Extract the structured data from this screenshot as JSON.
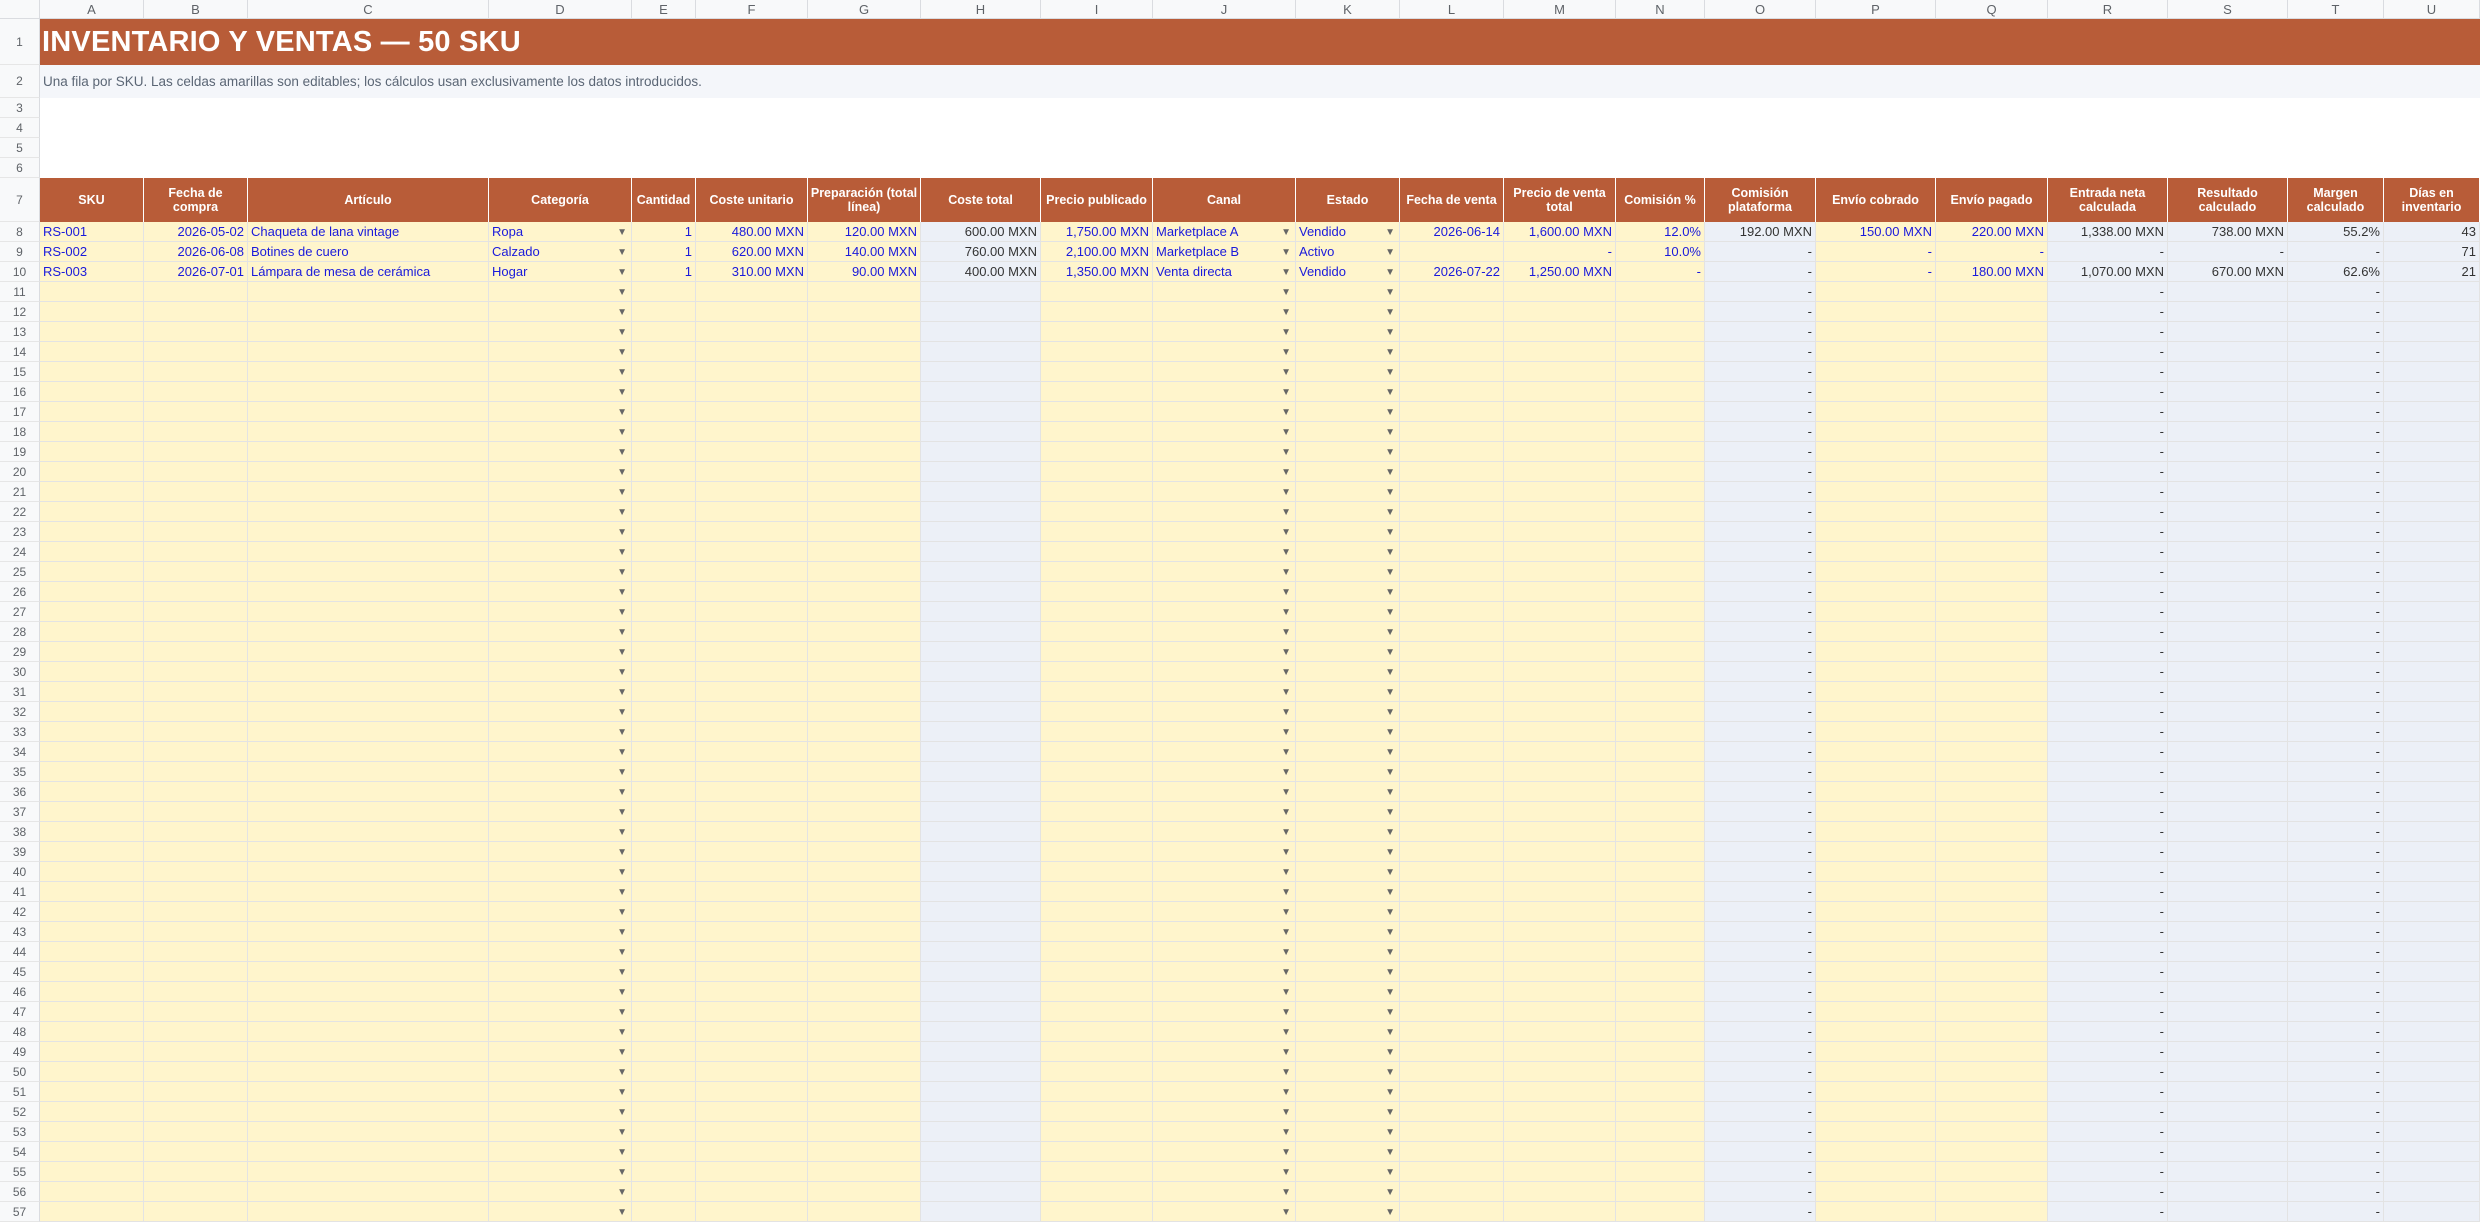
{
  "columns": [
    "A",
    "B",
    "C",
    "D",
    "E",
    "F",
    "G",
    "H",
    "I",
    "J",
    "K",
    "L",
    "M",
    "N",
    "O",
    "P",
    "Q",
    "R",
    "S",
    "T",
    "U"
  ],
  "title": "INVENTARIO Y VENTAS — 50 SKU",
  "subtitle": "Una fila por SKU. Las celdas amarillas son editables; los cálculos usan exclusivamente los datos introducidos.",
  "headers": [
    "SKU",
    "Fecha de compra",
    "Artículo",
    "Categoría",
    "Cantidad",
    "Coste unitario",
    "Preparación (total línea)",
    "Coste total",
    "Precio publicado",
    "Canal",
    "Estado",
    "Fecha de venta",
    "Precio de venta total",
    "Comisión %",
    "Comisión plataforma",
    "Envío cobrado",
    "Envío pagado",
    "Entrada neta calculada",
    "Resultado calculado",
    "Margen calculado",
    "Días en inventario"
  ],
  "rows": [
    {
      "row_number": "8",
      "cells": [
        "RS-001",
        "2026-05-02",
        "Chaqueta de lana vintage",
        "Ropa",
        "1",
        "480.00 MXN",
        "120.00 MXN",
        "600.00 MXN",
        "1,750.00 MXN",
        "Marketplace A",
        "Vendido",
        "2026-06-14",
        "1,600.00 MXN",
        "12.0%",
        "192.00 MXN",
        "150.00 MXN",
        "220.00 MXN",
        "1,338.00 MXN",
        "738.00 MXN",
        "55.2%",
        "43"
      ]
    },
    {
      "row_number": "9",
      "cells": [
        "RS-002",
        "2026-06-08",
        "Botines de cuero",
        "Calzado",
        "1",
        "620.00 MXN",
        "140.00 MXN",
        "760.00 MXN",
        "2,100.00 MXN",
        "Marketplace B",
        "Activo",
        "",
        "-",
        "10.0%",
        "-",
        "-",
        "-",
        "-",
        "-",
        "-",
        "71"
      ]
    },
    {
      "row_number": "10",
      "cells": [
        "RS-003",
        "2026-07-01",
        "Lámpara de mesa de cerámica",
        "Hogar",
        "1",
        "310.00 MXN",
        "90.00 MXN",
        "400.00 MXN",
        "1,350.00 MXN",
        "Venta directa",
        "Vendido",
        "2026-07-22",
        "1,250.00 MXN",
        "-",
        "-",
        "-",
        "180.00 MXN",
        "1,070.00 MXN",
        "670.00 MXN",
        "62.6%",
        "21"
      ]
    }
  ],
  "empty_rows": {
    "row_numbers": [
      "11",
      "12",
      "13",
      "14",
      "15",
      "16",
      "17",
      "18",
      "19",
      "20",
      "21",
      "22",
      "23",
      "24",
      "25",
      "26",
      "27",
      "28",
      "29",
      "30",
      "31",
      "32",
      "33",
      "34",
      "35",
      "36",
      "37",
      "38",
      "39",
      "40",
      "41",
      "42",
      "43",
      "44",
      "45",
      "46",
      "47",
      "48",
      "49",
      "50",
      "51",
      "52",
      "53",
      "54",
      "55",
      "56",
      "57"
    ],
    "dash_value": "-"
  },
  "dropdown_glyph": "▼",
  "colors": {
    "header_bg": "#b85c38",
    "input_bg": "#fff5cc",
    "input_text": "#1a1adb",
    "calc_bg": "#ecf0f7",
    "subtitle_bg": "#f4f6fa"
  }
}
